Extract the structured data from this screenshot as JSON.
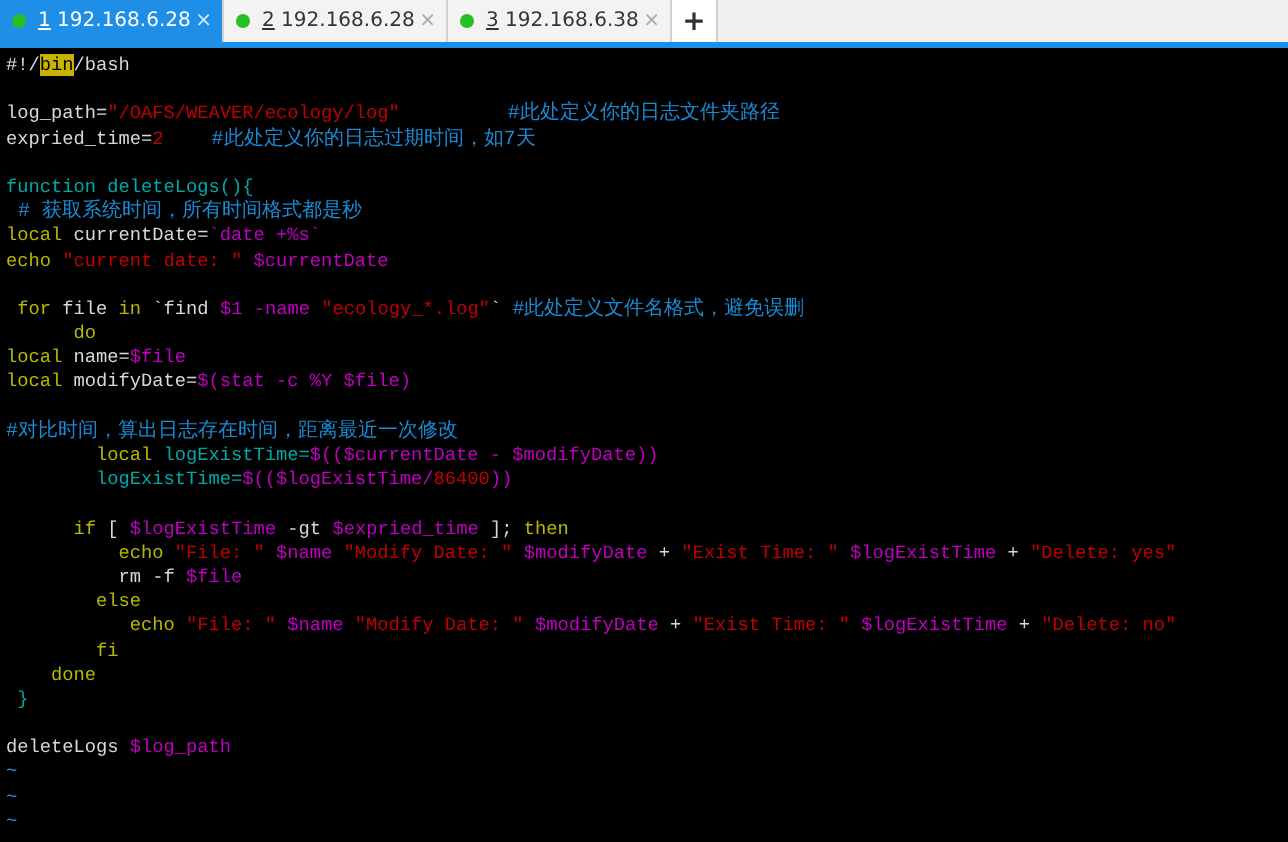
{
  "tabs": [
    {
      "number": "1",
      "label": "192.168.6.28",
      "close": "×",
      "selected": true
    },
    {
      "number": "2",
      "label": "192.168.6.28",
      "close": "×",
      "selected": false
    },
    {
      "number": "3",
      "label": "192.168.6.38",
      "close": "×",
      "selected": false
    }
  ],
  "new_tab": "+",
  "editor": {
    "lines": [
      {
        "kind": "code",
        "segments": [
          {
            "kind": "plain",
            "text": "#!/"
          },
          {
            "kind": "match",
            "text": "bin"
          },
          {
            "kind": "plain",
            "text": "/bash"
          }
        ]
      },
      {
        "kind": "blank"
      },
      {
        "kind": "code",
        "segments": [
          {
            "kind": "plain",
            "text": "log_path="
          },
          {
            "kind": "string",
            "text": "\"/OAFS/WEAVER/ecology/log\""
          },
          {
            "kind": "comment",
            "text": "         #此处定义你的日志文件夹路径"
          }
        ]
      },
      {
        "kind": "code",
        "segments": [
          {
            "kind": "plain",
            "text": "expried_time="
          },
          {
            "kind": "string",
            "text": "2"
          },
          {
            "kind": "comment",
            "text": "    #此处定义你的日志过期时间，如7天"
          }
        ]
      },
      {
        "kind": "blank"
      },
      {
        "kind": "code",
        "segments": [
          {
            "kind": "function",
            "text": "function deleteLogs(){"
          }
        ]
      },
      {
        "kind": "code",
        "segments": [
          {
            "kind": "comment",
            "text": " # 获取系统时间，所有时间格式都是秒"
          }
        ]
      },
      {
        "kind": "code",
        "segments": [
          {
            "kind": "keyword",
            "text": "local"
          },
          {
            "kind": "plain",
            "text": " currentDate="
          },
          {
            "kind": "variable",
            "text": "`date +%s`"
          }
        ]
      },
      {
        "kind": "code",
        "segments": [
          {
            "kind": "keyword",
            "text": "echo"
          },
          {
            "kind": "string",
            "text": " \"current date: \""
          },
          {
            "kind": "variable",
            "text": " $currentDate"
          }
        ]
      },
      {
        "kind": "blank"
      },
      {
        "kind": "code",
        "segments": [
          {
            "kind": "keyword",
            "text": " for"
          },
          {
            "kind": "plain",
            "text": " file "
          },
          {
            "kind": "keyword",
            "text": "in"
          },
          {
            "kind": "plain",
            "text": " `find "
          },
          {
            "kind": "variable",
            "text": "$1 -name"
          },
          {
            "kind": "string",
            "text": " \"ecology_*.log\""
          },
          {
            "kind": "plain",
            "text": "` "
          },
          {
            "kind": "comment",
            "text": "#此处定义文件名格式，避免误删"
          }
        ]
      },
      {
        "kind": "code",
        "segments": [
          {
            "kind": "keyword",
            "text": "      do"
          }
        ]
      },
      {
        "kind": "code",
        "segments": [
          {
            "kind": "keyword",
            "text": "local"
          },
          {
            "kind": "plain",
            "text": " name="
          },
          {
            "kind": "variable",
            "text": "$file"
          }
        ]
      },
      {
        "kind": "code",
        "segments": [
          {
            "kind": "keyword",
            "text": "local"
          },
          {
            "kind": "plain",
            "text": " modifyDate="
          },
          {
            "kind": "variable",
            "text": "$(stat -c %Y $file)"
          }
        ]
      },
      {
        "kind": "blank"
      },
      {
        "kind": "code",
        "segments": [
          {
            "kind": "comment",
            "text": "#对比时间，算出日志存在时间，距离最近一次修改"
          }
        ]
      },
      {
        "kind": "code",
        "segments": [
          {
            "kind": "keyword",
            "text": "        local"
          },
          {
            "kind": "function",
            "text": " logExistTime="
          },
          {
            "kind": "variable",
            "text": "$(($currentDate - $modifyDate))"
          }
        ]
      },
      {
        "kind": "code",
        "segments": [
          {
            "kind": "function",
            "text": "        logExistTime="
          },
          {
            "kind": "variable",
            "text": "$(($logExistTime/"
          },
          {
            "kind": "string",
            "text": "86400"
          },
          {
            "kind": "variable",
            "text": "))"
          }
        ]
      },
      {
        "kind": "blank"
      },
      {
        "kind": "code",
        "segments": [
          {
            "kind": "keyword",
            "text": "      if"
          },
          {
            "kind": "plain",
            "text": " [ "
          },
          {
            "kind": "variable",
            "text": "$logExistTime"
          },
          {
            "kind": "plain",
            "text": " -gt "
          },
          {
            "kind": "variable",
            "text": "$expried_time"
          },
          {
            "kind": "plain",
            "text": " ]; "
          },
          {
            "kind": "keyword",
            "text": "then"
          }
        ]
      },
      {
        "kind": "code",
        "segments": [
          {
            "kind": "keyword",
            "text": "          echo"
          },
          {
            "kind": "string",
            "text": " \"File: \""
          },
          {
            "kind": "variable",
            "text": " $name"
          },
          {
            "kind": "string",
            "text": " \"Modify Date: \""
          },
          {
            "kind": "variable",
            "text": " $modifyDate"
          },
          {
            "kind": "plain",
            "text": " + "
          },
          {
            "kind": "string",
            "text": "\"Exist Time: \""
          },
          {
            "kind": "variable",
            "text": " $logExistTime"
          },
          {
            "kind": "plain",
            "text": " + "
          },
          {
            "kind": "string",
            "text": "\"Delete: yes\""
          }
        ]
      },
      {
        "kind": "code",
        "segments": [
          {
            "kind": "plain",
            "text": "          rm -f "
          },
          {
            "kind": "variable",
            "text": "$file"
          }
        ]
      },
      {
        "kind": "code",
        "segments": [
          {
            "kind": "keyword",
            "text": "        else"
          }
        ]
      },
      {
        "kind": "code",
        "segments": [
          {
            "kind": "keyword",
            "text": "           echo"
          },
          {
            "kind": "string",
            "text": " \"File: \""
          },
          {
            "kind": "variable",
            "text": " $name"
          },
          {
            "kind": "string",
            "text": " \"Modify Date: \""
          },
          {
            "kind": "variable",
            "text": " $modifyDate"
          },
          {
            "kind": "plain",
            "text": " + "
          },
          {
            "kind": "string",
            "text": "\"Exist Time: \""
          },
          {
            "kind": "variable",
            "text": " $logExistTime"
          },
          {
            "kind": "plain",
            "text": " + "
          },
          {
            "kind": "string",
            "text": "\"Delete: no\""
          }
        ]
      },
      {
        "kind": "code",
        "segments": [
          {
            "kind": "keyword",
            "text": "        fi"
          }
        ]
      },
      {
        "kind": "code",
        "segments": [
          {
            "kind": "keyword",
            "text": "    done"
          }
        ]
      },
      {
        "kind": "code",
        "segments": [
          {
            "kind": "function",
            "text": " }"
          }
        ]
      },
      {
        "kind": "blank"
      },
      {
        "kind": "code",
        "segments": [
          {
            "kind": "plain",
            "text": "deleteLogs "
          },
          {
            "kind": "variable",
            "text": "$log_path"
          }
        ]
      },
      {
        "kind": "tilde",
        "text": "~"
      },
      {
        "kind": "tilde",
        "text": "~"
      },
      {
        "kind": "tilde",
        "text": "~"
      }
    ]
  }
}
